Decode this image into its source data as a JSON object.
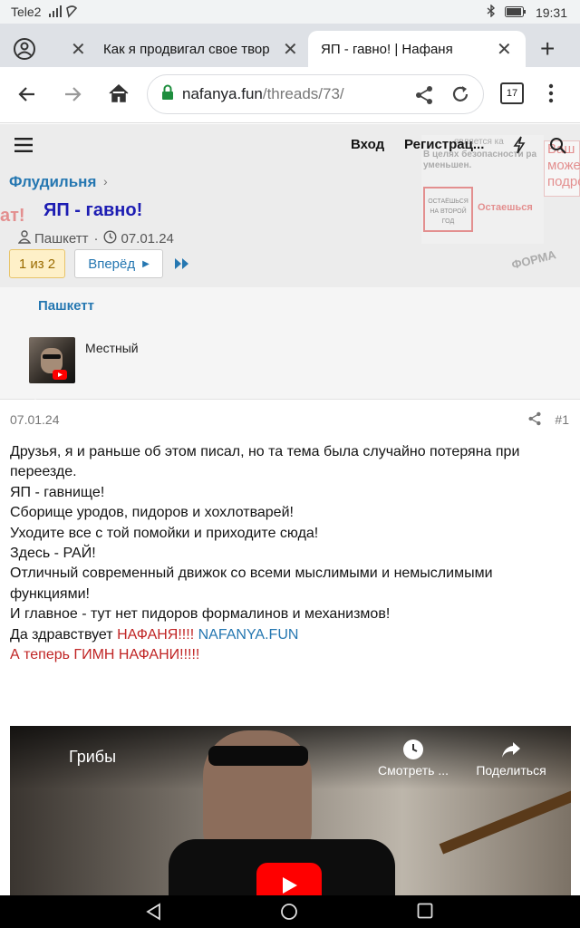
{
  "status": {
    "carrier": "Tele2",
    "time": "19:31"
  },
  "tabs": [
    {
      "title": "Как я продвигал свое твор"
    },
    {
      "title": "ЯП - гавно! | Нафаня"
    }
  ],
  "address": {
    "domain": "nafanya.fun",
    "path": "/threads/73/",
    "tab_count": "17"
  },
  "site": {
    "login": "Вход",
    "register": "Регистрац...",
    "breadcrumb": "Флудильня",
    "thread_title": "ЯП - гавно!",
    "author": "Пашкетт",
    "date": "07.01.24",
    "page_current": "1 из 2",
    "page_next": "Вперёд",
    "promo_text_1": "В целях безопасности ра уменьшен.",
    "promo_badge": "ОСТАЁШЬСЯ НА ВТОРОЙ ГОД",
    "promo_stay": "Остаешься",
    "promo_side_1": "Ваш",
    "promo_side_2": "може",
    "promo_side_3": "подро",
    "promo_watermark": "ФОРМА",
    "promo_left": "ат!",
    "promo_top": "является ка"
  },
  "post_author": {
    "name": "Пашкетт",
    "role": "Местный"
  },
  "post": {
    "date": "07.01.24",
    "number": "#1",
    "lines": [
      "Друзья, я и раньше об этом писал, но та тема была случайно потеряна при переезде.",
      "ЯП - гавнище!",
      "Сборище уродов, пидоров и хохлотварей!",
      "Уходите все с той помойки и приходите сюда!",
      "Здесь - РАЙ!",
      "Отличный современный движок со всеми мыслимыми и немыслимыми функциями!",
      "И главное - тут нет пидоров формалинов и механизмов!"
    ],
    "long_live_prefix": "Да здравствует ",
    "long_live_red": "НАФАНЯ!!!!",
    "long_live_link": "NAFANYA.FUN",
    "anthem": "А теперь ГИМН НАФАНИ!!!!!"
  },
  "video": {
    "title": "Грибы",
    "watch_later": "Смотреть ...",
    "share": "Поделиться"
  },
  "colors": {
    "accent": "#2577b1",
    "red": "#c02525",
    "title_blue": "#1d1db3",
    "youtube": "#ff0000"
  }
}
